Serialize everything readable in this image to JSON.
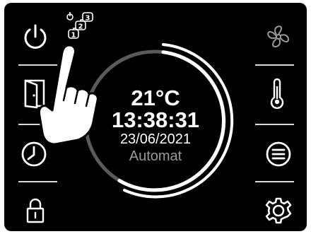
{
  "status": {
    "temperature": "21°C",
    "time": "13:38:31",
    "date": "23/06/2021",
    "mode": "Automat"
  },
  "tutorial_badges": [
    "1",
    "2",
    "3"
  ],
  "left_buttons": [
    {
      "id": "power",
      "icon": "power-icon"
    },
    {
      "id": "door",
      "icon": "door-icon"
    },
    {
      "id": "timer",
      "icon": "clock-icon"
    },
    {
      "id": "lock",
      "icon": "lock-icon"
    }
  ],
  "right_buttons": [
    {
      "id": "fan",
      "icon": "fan-icon"
    },
    {
      "id": "temperature",
      "icon": "thermometer-icon"
    },
    {
      "id": "menu",
      "icon": "menu-icon"
    },
    {
      "id": "settings",
      "icon": "gear-icon"
    }
  ],
  "colors": {
    "background": "#000000",
    "foreground": "#ffffff",
    "dim": "#9a9a9a",
    "ring_dim": "#5a5a5a"
  }
}
